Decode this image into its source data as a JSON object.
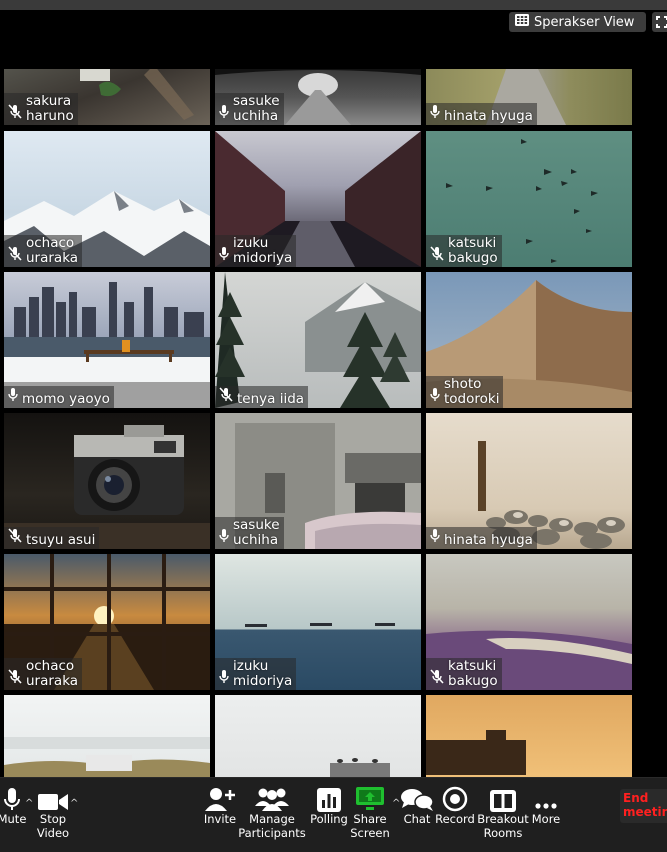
{
  "header": {
    "view_button_label": "Sperakser View"
  },
  "tiles": [
    {
      "name": "sakura\nharuno",
      "muted": true
    },
    {
      "name": "sasuke\nuchiha",
      "muted": false
    },
    {
      "name": "hinata hyuga",
      "muted": false
    },
    {
      "name": "ochaco\nuraraka",
      "muted": true
    },
    {
      "name": "izuku\nmidoriya",
      "muted": false
    },
    {
      "name": "katsuki\nbakugo",
      "muted": true
    },
    {
      "name": "momo yaoyo",
      "muted": false
    },
    {
      "name": "tenya iida",
      "muted": true
    },
    {
      "name": "shoto\ntodoroki",
      "muted": false
    },
    {
      "name": "tsuyu asui",
      "muted": true
    },
    {
      "name": "sasuke\nuchiha",
      "muted": false
    },
    {
      "name": "hinata hyuga",
      "muted": false
    },
    {
      "name": "ochaco\nuraraka",
      "muted": true
    },
    {
      "name": "izuku\nmidoriya",
      "muted": false
    },
    {
      "name": "katsuki\nbakugo",
      "muted": true
    }
  ],
  "toolbar": {
    "mute": "Mute",
    "stop_video": "Stop\nVideo",
    "invite": "Invite",
    "manage_participants": "Manage\nParticipants",
    "polling": "Polling",
    "share_screen": "Share\nScreen",
    "chat": "Chat",
    "record": "Record",
    "breakout_rooms": "Breakout\nRooms",
    "more": "More",
    "end_meeting": "End\nmeeting"
  },
  "colors": {
    "share_screen_accent": "#1fbf2f",
    "end_meeting": "#ff2020"
  }
}
